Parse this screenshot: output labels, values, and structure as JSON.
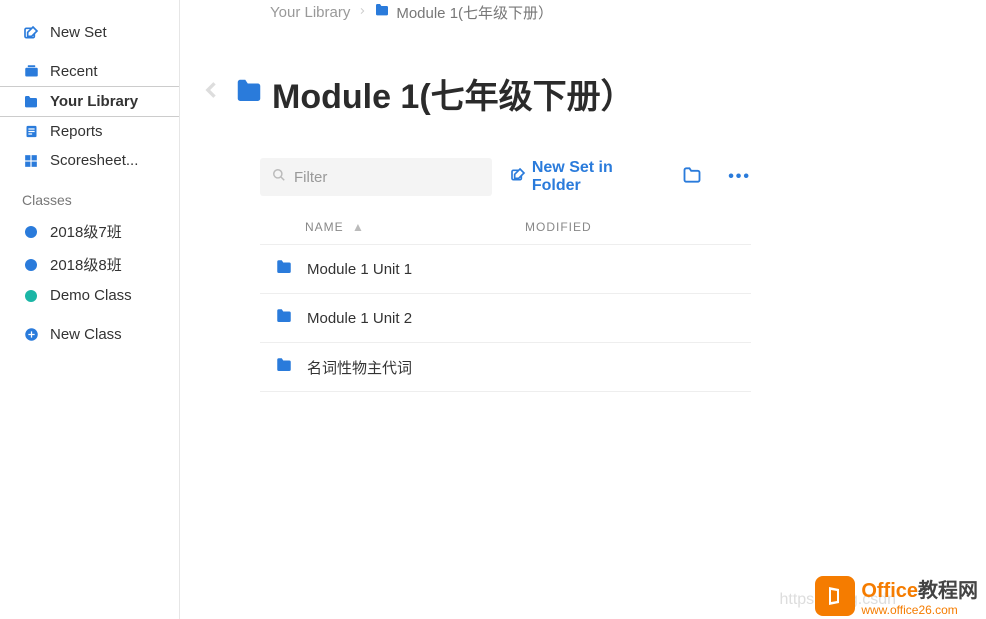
{
  "sidebar": {
    "newSet": "New Set",
    "nav": {
      "recent": "Recent",
      "library": "Your Library",
      "reports": "Reports",
      "scoresheet": "Scoresheet..."
    },
    "classesHeading": "Classes",
    "classes": [
      {
        "name": "2018级7班",
        "color": "#2a7bdb"
      },
      {
        "name": "2018级8班",
        "color": "#2a7bdb"
      },
      {
        "name": "Demo Class",
        "color": "#1bb6a6"
      }
    ],
    "newClass": "New Class"
  },
  "breadcrumb": {
    "root": "Your Library",
    "current": "Module 1(七年级下册）"
  },
  "title": "Module 1(七年级下册）",
  "toolbar": {
    "filterPlaceholder": "Filter",
    "newSetInFolder": "New Set in Folder"
  },
  "table": {
    "headers": {
      "name": "NAME",
      "modified": "MODIFIED"
    },
    "rows": [
      {
        "name": "Module 1 Unit 1"
      },
      {
        "name": "Module 1 Unit 2"
      },
      {
        "name": "名词性物主代词"
      }
    ]
  },
  "watermark": {
    "url": "https://blog.csdn",
    "brand1": "Office",
    "brand2": "教程网",
    "domain": "www.office26.com"
  }
}
